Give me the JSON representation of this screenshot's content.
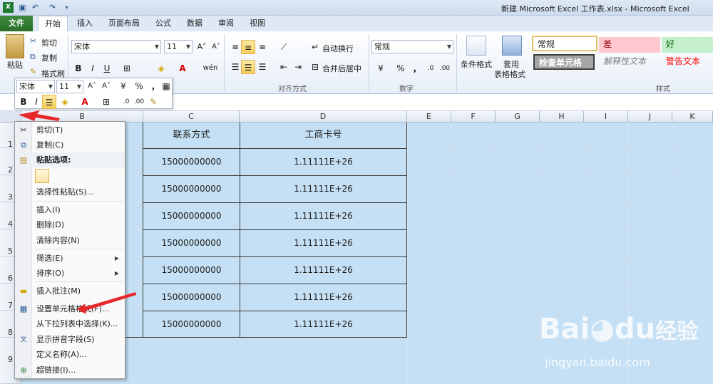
{
  "window": {
    "title": "新建 Microsoft Excel 工作表.xlsx - Microsoft Excel"
  },
  "tabs": [
    "文件",
    "开始",
    "插入",
    "页面布局",
    "公式",
    "数据",
    "审阅",
    "视图"
  ],
  "ribbon": {
    "clipboard": {
      "paste": "粘贴",
      "cut": "剪切",
      "copy": "复制",
      "format_painter": "格式刷"
    },
    "font": {
      "name": "宋体",
      "size": "11",
      "bold": "B",
      "italic": "I",
      "underline": "U",
      "phonetic": "wén"
    },
    "alignment": {
      "wrap_text": "自动换行",
      "merge_center": "合并后居中",
      "group_label": "对齐方式"
    },
    "number": {
      "format": "常规",
      "group_label": "数字"
    },
    "styles": {
      "conditional": "条件格式",
      "table_format_1": "套用",
      "table_format_2": "表格格式",
      "normal": "常规",
      "bad": "差",
      "good": "好",
      "check_cell": "检查单元格",
      "explanatory": "解释性文本",
      "warning": "警告文本",
      "group_label": "样式"
    }
  },
  "mini_toolbar": {
    "font": "宋体",
    "size": "11",
    "bold": "B",
    "italic": "I"
  },
  "columns": [
    "B",
    "C",
    "D",
    "E",
    "F",
    "G",
    "H",
    "I",
    "J",
    "K"
  ],
  "rows": [
    "1",
    "2",
    "3",
    "4",
    "5",
    "6",
    "7",
    "8",
    "9"
  ],
  "table": {
    "headers": [
      "联系方式",
      "工商卡号"
    ],
    "rows": [
      [
        "15000000000",
        "1.11111E+26"
      ],
      [
        "15000000000",
        "1.11111E+26"
      ],
      [
        "15000000000",
        "1.11111E+26"
      ],
      [
        "15000000000",
        "1.11111E+26"
      ],
      [
        "15000000000",
        "1.11111E+26"
      ],
      [
        "15000000000",
        "1.11111E+26"
      ],
      [
        "15000000000",
        "1.11111E+26"
      ]
    ]
  },
  "context_menu": {
    "items": [
      {
        "label": "剪切(T)",
        "icon": "scissors-icon"
      },
      {
        "label": "复制(C)",
        "icon": "copy-icon"
      },
      {
        "label": "粘贴选项:",
        "icon": "paste-icon"
      },
      {
        "label": "选择性粘贴(S)..."
      },
      {
        "label": "插入(I)"
      },
      {
        "label": "删除(D)"
      },
      {
        "label": "清除内容(N)"
      },
      {
        "label": "筛选(E)"
      },
      {
        "label": "排序(O)"
      },
      {
        "label": "插入批注(M)",
        "icon": "comment-icon"
      },
      {
        "label": "设置单元格格式(F)...",
        "icon": "format-cells-icon"
      },
      {
        "label": "从下拉列表中选择(K)..."
      },
      {
        "label": "显示拼音字段(S)",
        "icon": "phonetic-icon"
      },
      {
        "label": "定义名称(A)..."
      },
      {
        "label": "超链接(I)...",
        "icon": "hyperlink-icon"
      }
    ]
  },
  "watermark": {
    "brand": "Bai",
    "brand2": "du",
    "brand_cn": "经验",
    "url": "jingyan.baidu.com"
  },
  "colors": {
    "selection": "#c5e0f4",
    "file_tab": "#2a6e2a",
    "arrow": "#e8272b"
  }
}
